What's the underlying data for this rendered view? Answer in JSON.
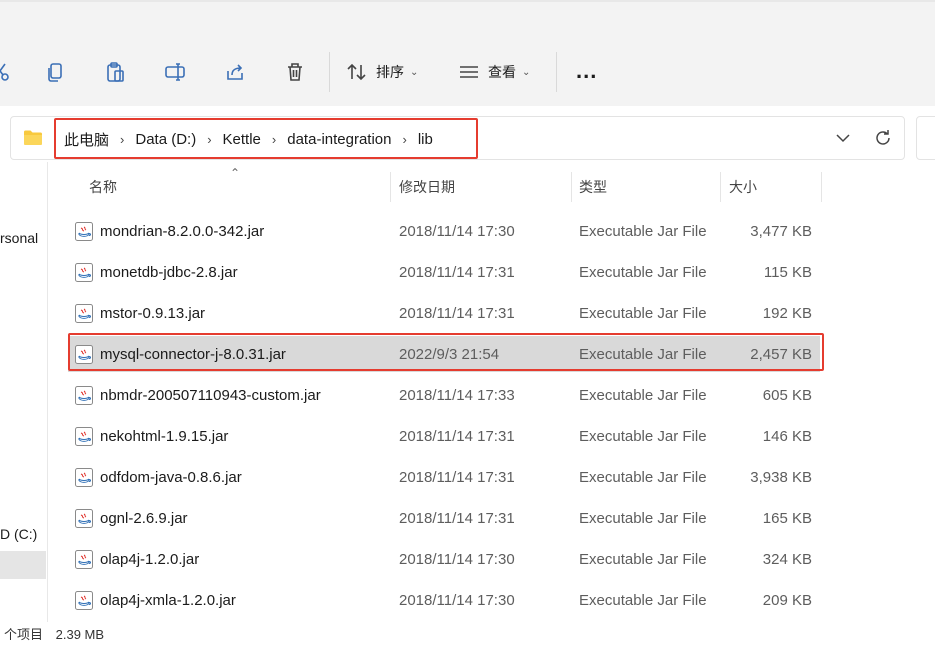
{
  "toolbar": {
    "sort_label": "排序",
    "view_label": "查看",
    "more_label": "..."
  },
  "address": {
    "crumbs": [
      "此电脑",
      "Data (D:)",
      "Kettle",
      "data-integration",
      "lib"
    ]
  },
  "nav": {
    "item_personal": "rsonal",
    "item_drive_c": "D (C:)"
  },
  "columns": {
    "name": "名称",
    "date": "修改日期",
    "type": "类型",
    "size": "大小"
  },
  "files": [
    {
      "name": "mondrian-8.2.0.0-342.jar",
      "date": "2018/11/14 17:30",
      "type": "Executable Jar File",
      "size": "3,477 KB"
    },
    {
      "name": "monetdb-jdbc-2.8.jar",
      "date": "2018/11/14 17:31",
      "type": "Executable Jar File",
      "size": "115 KB"
    },
    {
      "name": "mstor-0.9.13.jar",
      "date": "2018/11/14 17:31",
      "type": "Executable Jar File",
      "size": "192 KB"
    },
    {
      "name": "mysql-connector-j-8.0.31.jar",
      "date": "2022/9/3 21:54",
      "type": "Executable Jar File",
      "size": "2,457 KB"
    },
    {
      "name": "nbmdr-200507110943-custom.jar",
      "date": "2018/11/14 17:33",
      "type": "Executable Jar File",
      "size": "605 KB"
    },
    {
      "name": "nekohtml-1.9.15.jar",
      "date": "2018/11/14 17:31",
      "type": "Executable Jar File",
      "size": "146 KB"
    },
    {
      "name": "odfdom-java-0.8.6.jar",
      "date": "2018/11/14 17:31",
      "type": "Executable Jar File",
      "size": "3,938 KB"
    },
    {
      "name": "ognl-2.6.9.jar",
      "date": "2018/11/14 17:31",
      "type": "Executable Jar File",
      "size": "165 KB"
    },
    {
      "name": "olap4j-1.2.0.jar",
      "date": "2018/11/14 17:30",
      "type": "Executable Jar File",
      "size": "324 KB"
    },
    {
      "name": "olap4j-xmla-1.2.0.jar",
      "date": "2018/11/14 17:30",
      "type": "Executable Jar File",
      "size": "209 KB"
    }
  ],
  "status": {
    "items_text": "个项目",
    "size_text": "2.39 MB"
  },
  "colors": {
    "highlight_red": "#e53c2f",
    "selected_row": "#d9d9d9",
    "folder_yellow": "#f8c93e"
  }
}
